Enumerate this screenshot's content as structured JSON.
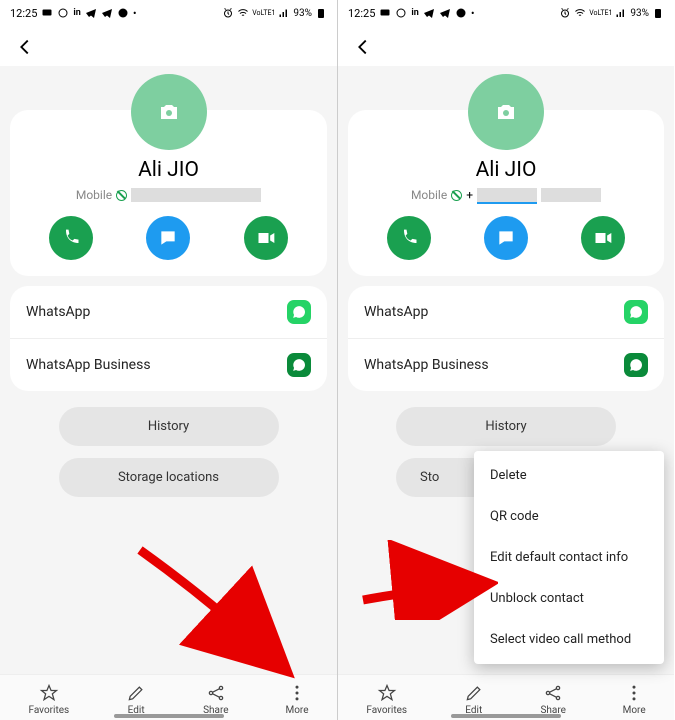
{
  "status": {
    "time": "12:25",
    "battery": "93%",
    "lte": "VoLTE1"
  },
  "contact": {
    "name": "Ali JIO",
    "phone_type": "Mobile",
    "plus": "+"
  },
  "apps": {
    "whatsapp": "WhatsApp",
    "whatsapp_business": "WhatsApp Business"
  },
  "pills": {
    "history": "History",
    "storage": "Storage locations",
    "storage_truncated": "Sto"
  },
  "bottom": {
    "favorites": "Favorites",
    "edit": "Edit",
    "share": "Share",
    "more": "More"
  },
  "menu": {
    "delete": "Delete",
    "qr": "QR code",
    "edit_default": "Edit default contact info",
    "unblock": "Unblock contact",
    "video_method": "Select video call method"
  }
}
